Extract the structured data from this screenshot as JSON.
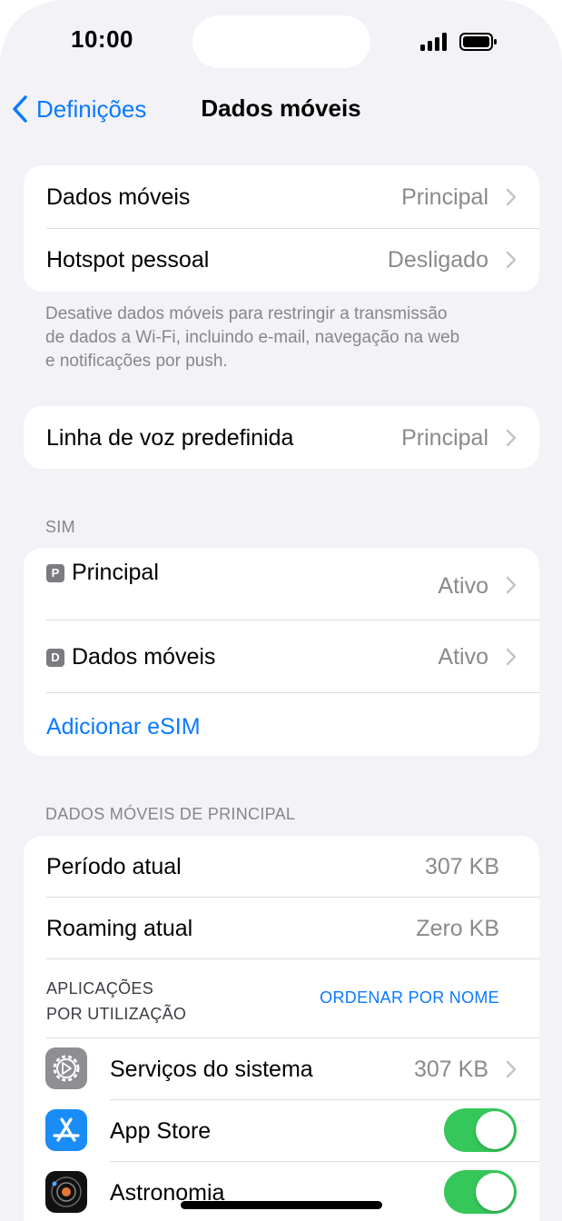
{
  "status": {
    "time": "10:00"
  },
  "nav": {
    "back_label": "Definições",
    "title": "Dados móveis"
  },
  "section1": {
    "rows": [
      {
        "label": "Dados móveis",
        "value": "Principal"
      },
      {
        "label": "Hotspot pessoal",
        "value": "Desligado"
      }
    ],
    "footer": [
      "Desative dados móveis para restringir a transmissão",
      "de dados a Wi-Fi, incluindo e-mail, navegação na web",
      "e notificações por push."
    ]
  },
  "section2": {
    "rows": [
      {
        "label": "Linha de voz predefinida",
        "value": "Principal"
      }
    ]
  },
  "sim": {
    "header": "SIM",
    "lines": [
      {
        "badge": "P",
        "label": "Principal",
        "value": "Ativo"
      },
      {
        "badge": "D",
        "label": "Dados móveis",
        "value": "Ativo"
      }
    ],
    "add_label": "Adicionar eSIM"
  },
  "usage": {
    "header": "DADOS MÓVEIS DE PRINCIPAL",
    "rows": [
      {
        "label": "Período atual",
        "value": "307 KB"
      },
      {
        "label": "Roaming atual",
        "value": "Zero KB"
      }
    ],
    "apps_header_line1": "APLICAÇÕES",
    "apps_header_line2": "POR UTILIZAÇÃO",
    "sort_label": "ORDENAR POR NOME",
    "apps": [
      {
        "name": "Serviços do sistema",
        "value": "307 KB",
        "icon": "gear-icon"
      },
      {
        "name": "App Store",
        "toggle": true,
        "icon": "app-store-icon"
      },
      {
        "name": "Astronomia",
        "toggle": true,
        "icon": "astronomy-icon"
      }
    ]
  },
  "colors": {
    "accent": "#0a7aff",
    "toggle_on": "#35c759",
    "secondary_text": "#8a8a8e",
    "background": "#f2f2f7"
  }
}
